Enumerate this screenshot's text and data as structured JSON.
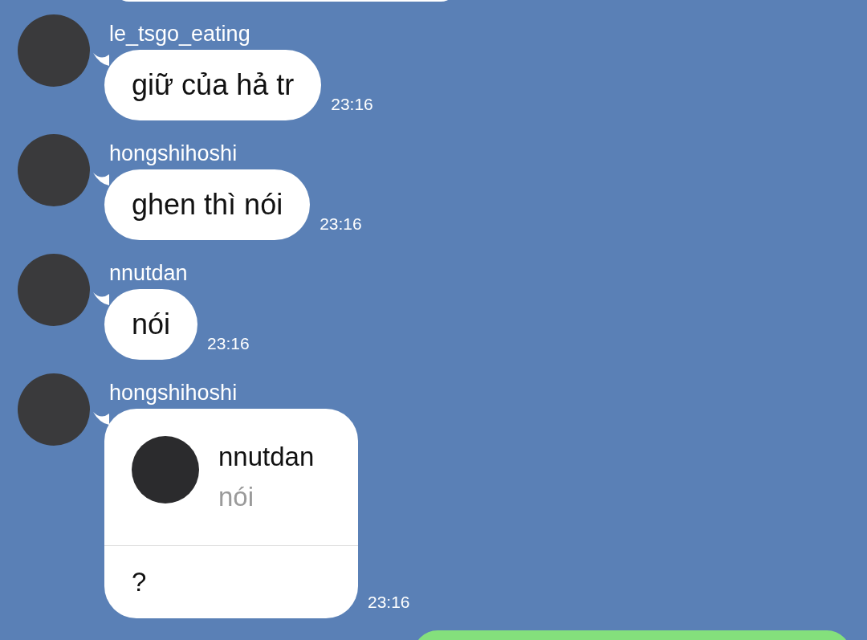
{
  "messages": [
    {
      "kind": "text",
      "sender": "le_tsgo_eating",
      "text": "giữ của hả tr",
      "time": "23:16"
    },
    {
      "kind": "text",
      "sender": "hongshihoshi",
      "text": "ghen thì nói",
      "time": "23:16"
    },
    {
      "kind": "text",
      "sender": "nnutdan",
      "text": "nói",
      "time": "23:16"
    },
    {
      "kind": "reply",
      "sender": "hongshihoshi",
      "quoted_sender": "nnutdan",
      "quoted_text": "nói",
      "text": "?",
      "time": "23:16"
    }
  ]
}
